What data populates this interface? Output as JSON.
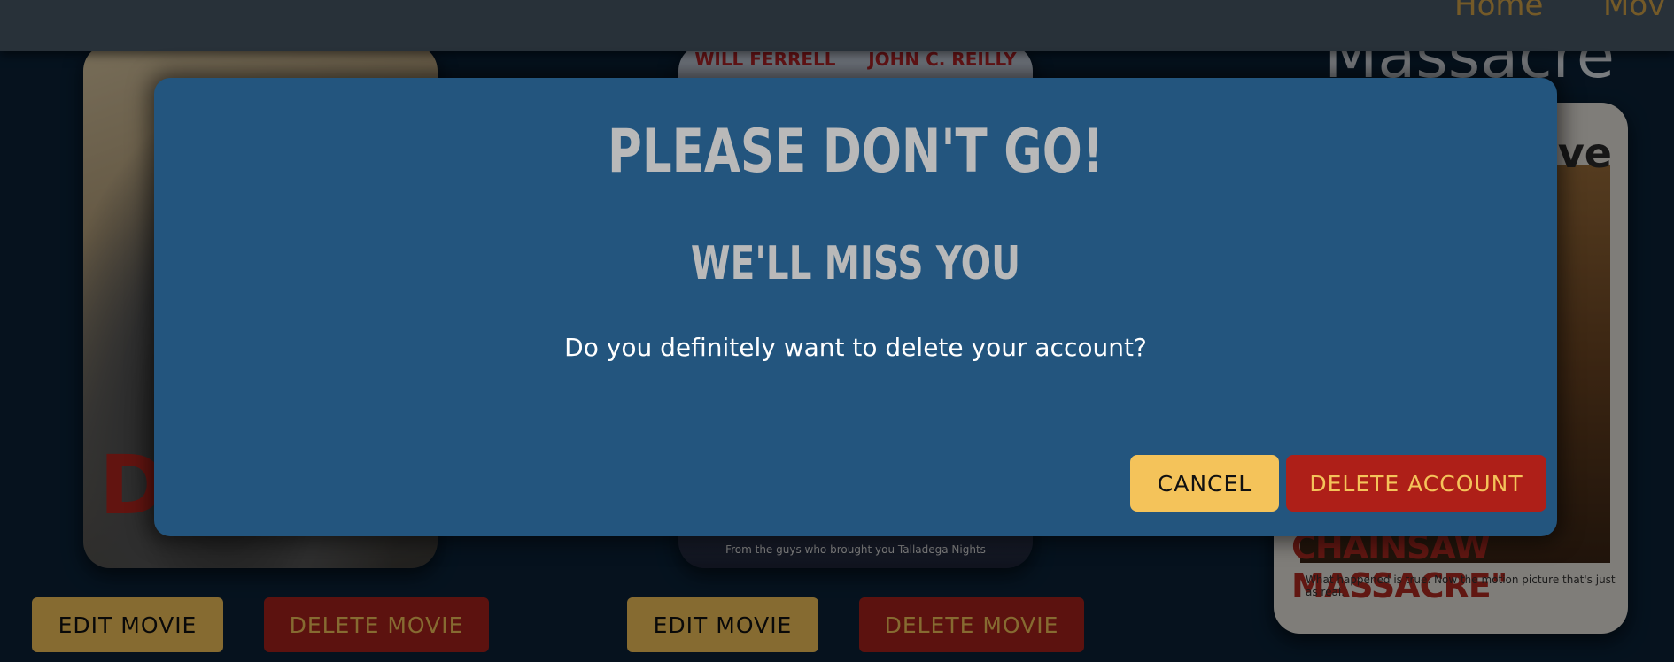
{
  "nav": {
    "home_label": "Home",
    "movies_label": "Mov"
  },
  "background": {
    "partial_movie_title": "Massacre",
    "posters": [
      {
        "name": "poster-1",
        "visible_letter": "D"
      },
      {
        "name": "poster-2",
        "actors": [
          "WILL FERRELL",
          "JOHN C. REILLY"
        ],
        "tagline": "From the guys who brought you Talladega Nights"
      },
      {
        "name": "poster-3",
        "headline": "ive",
        "title": "CHAINSAW MASSACRE\"",
        "tagline": "What happened is true. Now the motion picture that's just as real."
      }
    ],
    "buttons": {
      "edit_label": "EDIT MOVIE",
      "delete_label": "DELETE MOVIE"
    }
  },
  "modal": {
    "title": "PLEASE DON'T GO!",
    "subtitle": "WE'LL MISS YOU",
    "message": "Do you definitely want to delete your account?",
    "cancel_label": "CANCEL",
    "delete_label": "DELETE ACCOUNT"
  },
  "colors": {
    "modal_bg": "#23557e",
    "accent_yellow": "#f4c35a",
    "danger_red": "#ae1f18",
    "page_bg": "#0b2238"
  }
}
